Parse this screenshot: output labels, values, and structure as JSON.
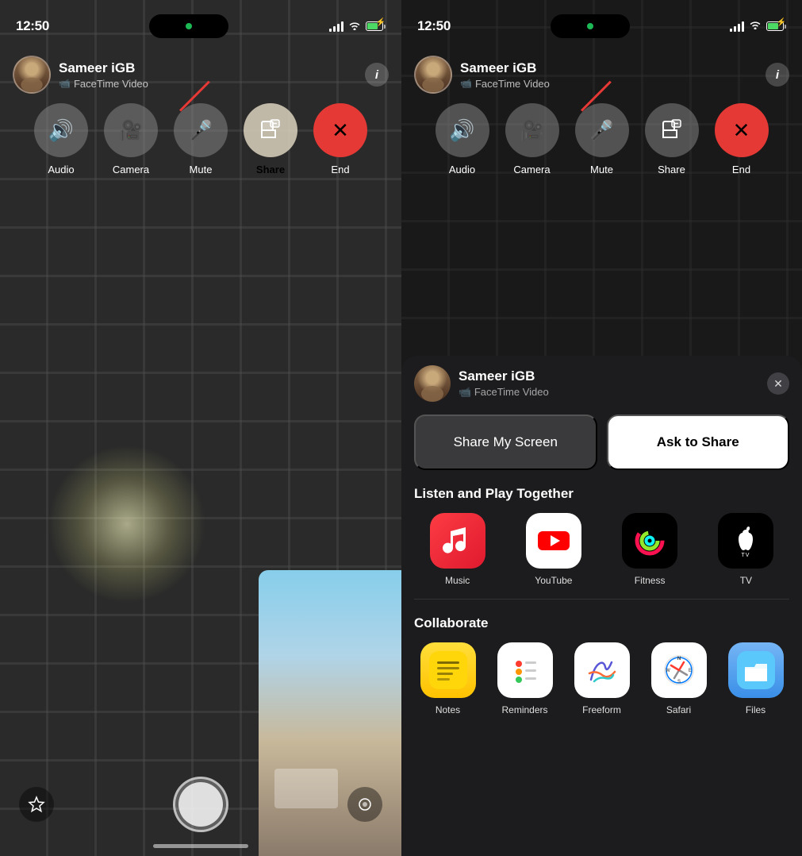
{
  "left_panel": {
    "status": {
      "time": "12:50",
      "signal_bars": [
        4,
        7,
        10,
        13
      ],
      "battery_percent": 70
    },
    "call": {
      "caller_name": "Sameer iGB",
      "caller_type": "FaceTime Video"
    },
    "controls": {
      "audio_label": "Audio",
      "camera_label": "Camera",
      "mute_label": "Mute",
      "share_label": "Share",
      "end_label": "End"
    }
  },
  "right_panel": {
    "status": {
      "time": "12:50"
    },
    "call": {
      "caller_name": "Sameer iGB",
      "caller_type": "FaceTime Video"
    },
    "controls": {
      "audio_label": "Audio",
      "camera_label": "Camera",
      "mute_label": "Mute",
      "share_label": "Share",
      "end_label": "End"
    },
    "sheet": {
      "caller_name": "Sameer iGB",
      "caller_type": "FaceTime Video",
      "share_my_screen": "Share My Screen",
      "ask_to_share": "Ask to Share",
      "listen_section": "Listen and Play Together",
      "collaborate_section": "Collaborate",
      "apps": {
        "listen": [
          {
            "name": "Music",
            "icon": "music"
          },
          {
            "name": "YouTube",
            "icon": "youtube"
          },
          {
            "name": "Fitness",
            "icon": "fitness"
          },
          {
            "name": "TV",
            "icon": "appletv"
          }
        ],
        "collaborate": [
          {
            "name": "Notes",
            "icon": "notes"
          },
          {
            "name": "Reminders",
            "icon": "reminders"
          },
          {
            "name": "Freeform",
            "icon": "freeform"
          },
          {
            "name": "Safari",
            "icon": "safari"
          },
          {
            "name": "Files",
            "icon": "files"
          }
        ]
      }
    }
  }
}
